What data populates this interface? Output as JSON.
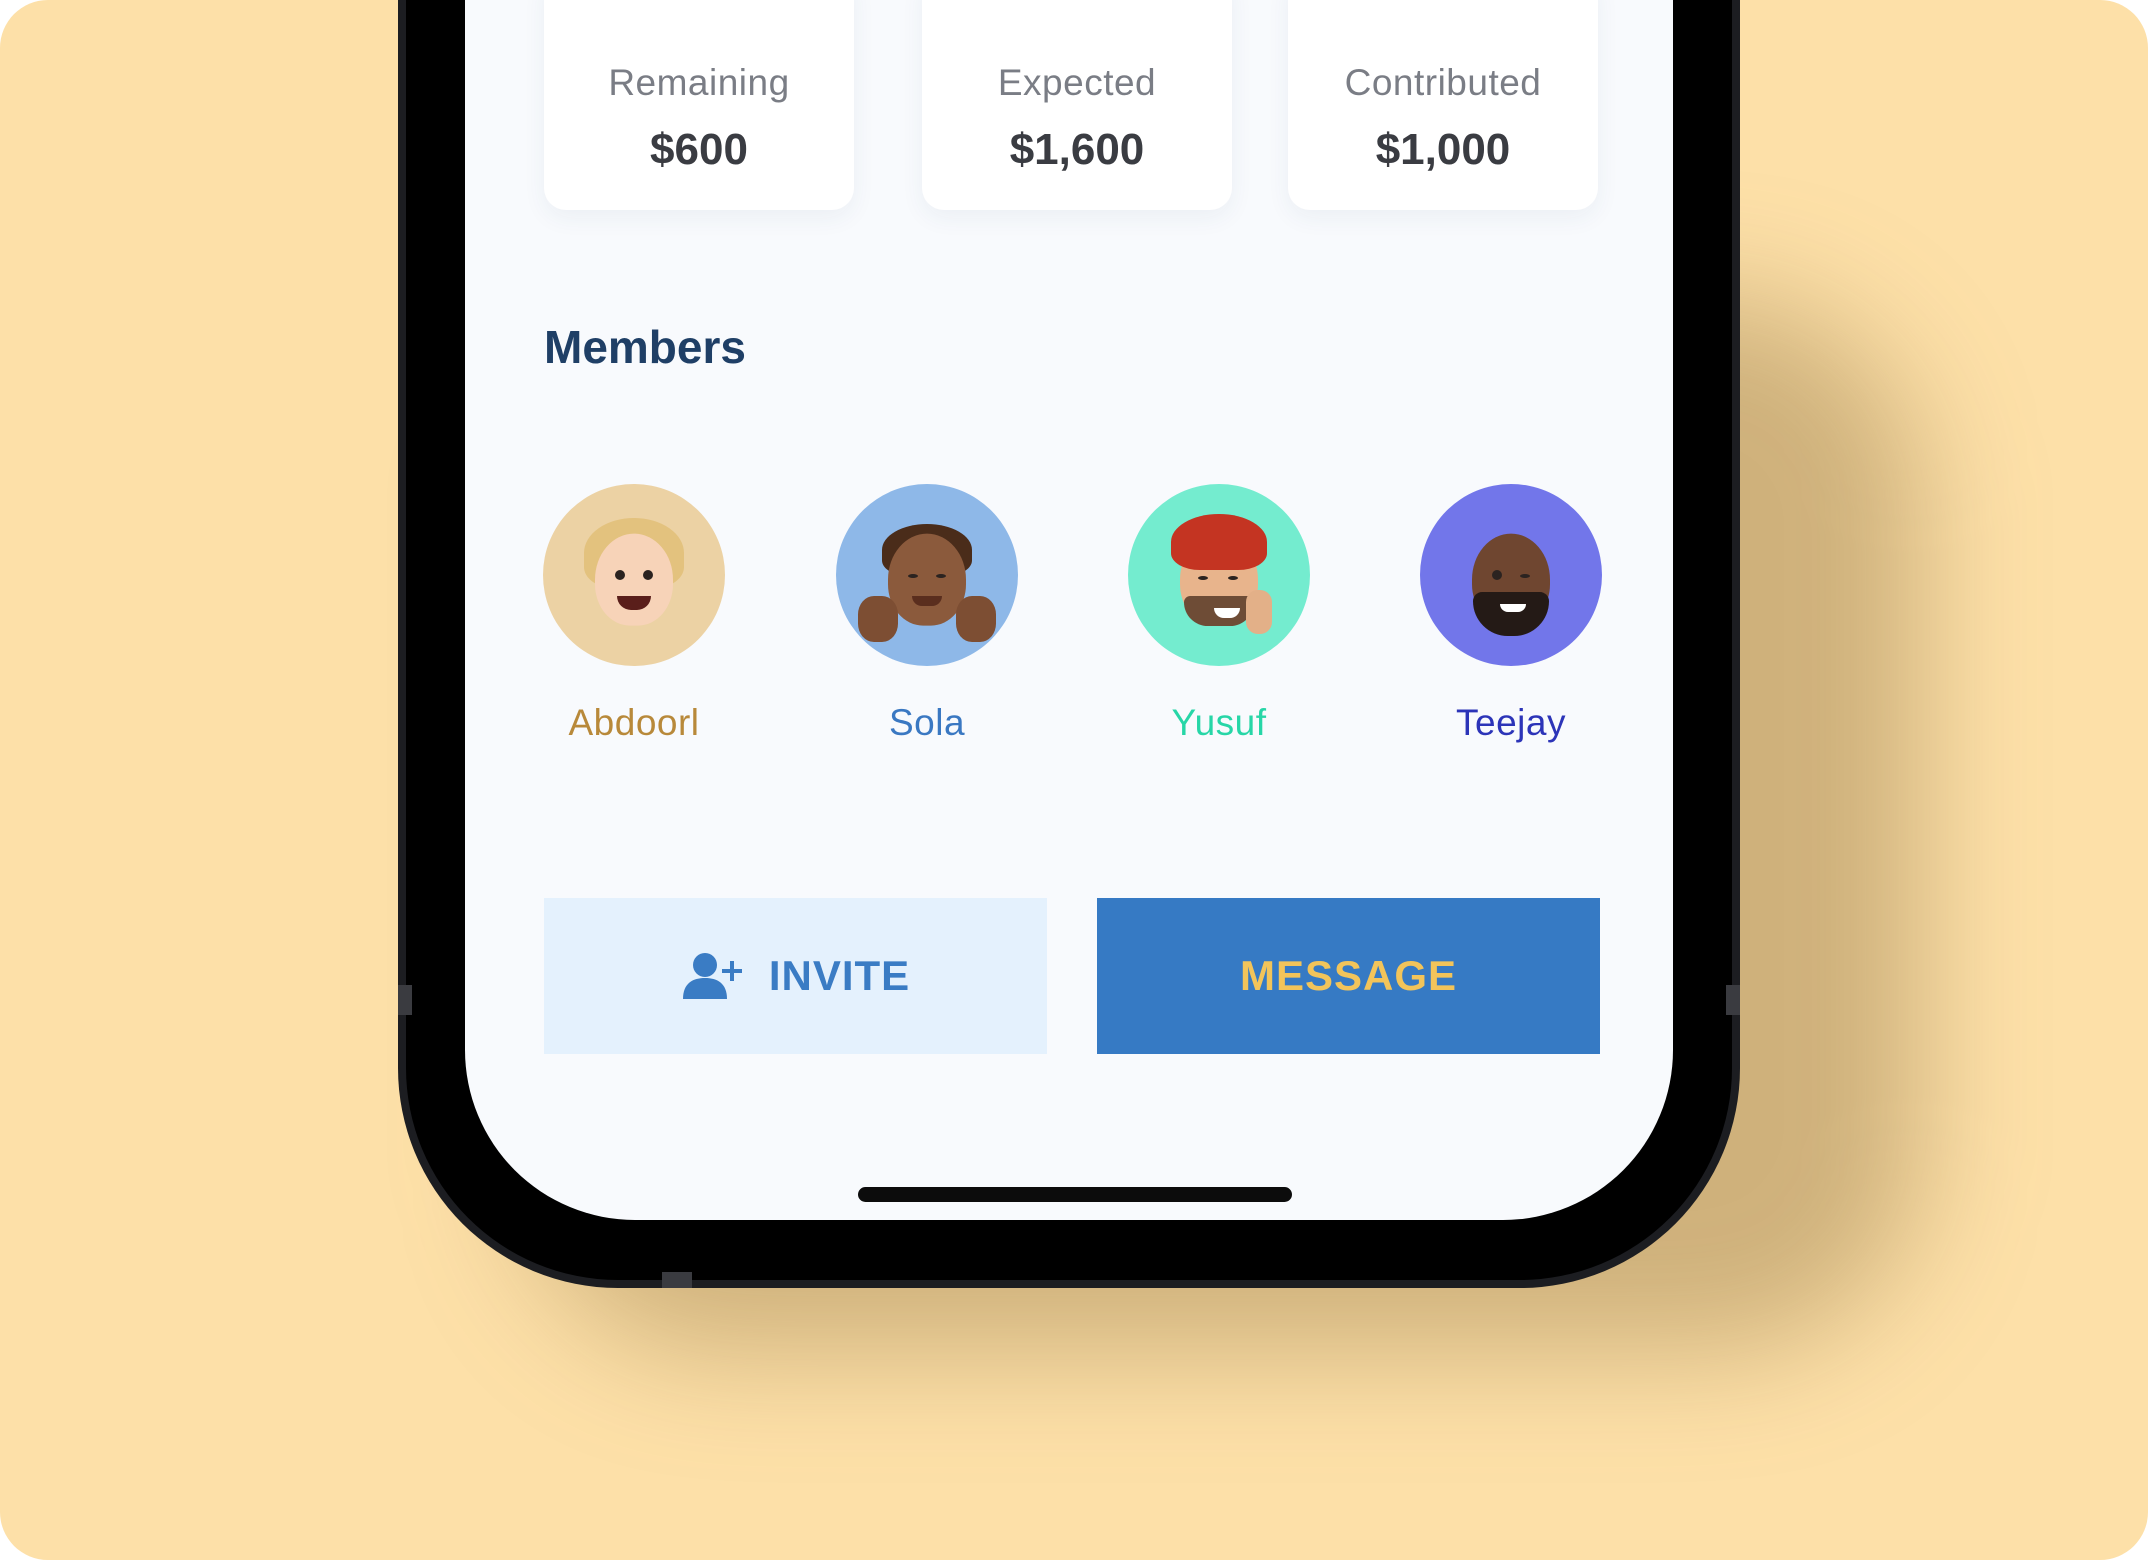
{
  "stats": [
    {
      "label": "Remaining",
      "value": "$600",
      "dot_color": "#fde0e0"
    },
    {
      "label": "Expected",
      "value": "$1,600",
      "dot_color": "#ececec"
    },
    {
      "label": "Contributed",
      "value": "$1,000",
      "dot_color": "#dcf8e4"
    }
  ],
  "members_section": {
    "title": "Members",
    "members": [
      {
        "name": "Abdoorl",
        "name_color": "#b8893a",
        "avatar_bg": "#ecd2a4",
        "avatar_icon": "memoji-blonde-woman"
      },
      {
        "name": "Sola",
        "name_color": "#3a78c2",
        "avatar_bg": "#8eb8e8",
        "avatar_icon": "memoji-waving-man"
      },
      {
        "name": "Yusuf",
        "name_color": "#27d6a7",
        "avatar_bg": "#74eccf",
        "avatar_icon": "memoji-turban-man"
      },
      {
        "name": "Teejay",
        "name_color": "#2c34b8",
        "avatar_bg": "#7276ea",
        "avatar_icon": "memoji-winking-man"
      }
    ]
  },
  "actions": {
    "invite_label": "INVITE",
    "invite_icon": "user-plus-icon",
    "message_label": "MESSAGE"
  },
  "colors": {
    "background": "#fde0a8",
    "screen": "#f8fafd",
    "title": "#1f3f66",
    "invite_bg": "#e4f1fd",
    "invite_text": "#3a7cc4",
    "message_bg": "#367ac4",
    "message_text": "#f2c45a"
  }
}
